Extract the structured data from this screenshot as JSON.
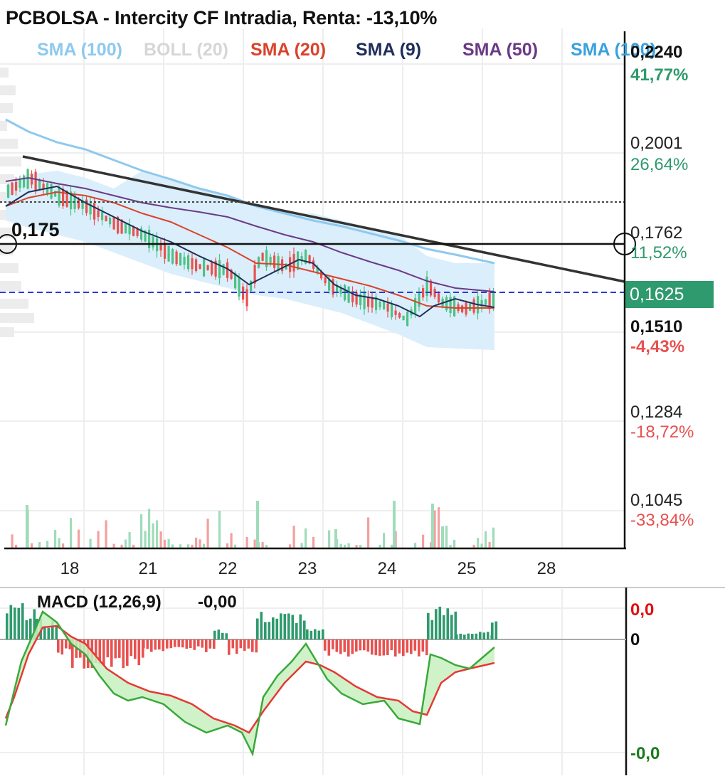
{
  "header": {
    "title": "PCBOLSA - Intercity CF Intradia, Renta: -13,10%"
  },
  "legend": [
    {
      "label": "SMA (100)",
      "color": "#8ec9ee"
    },
    {
      "label": "BOLL (20)",
      "color": "#d6d6d6"
    },
    {
      "label": "SMA (20)",
      "color": "#d9432b"
    },
    {
      "label": "SMA (9)",
      "color": "#1f2e5a"
    },
    {
      "label": "SMA (50)",
      "color": "#6a3a86"
    },
    {
      "label": "SMA (100)",
      "color": "#3aa2dc"
    }
  ],
  "price_axis": [
    {
      "price": "0,2240",
      "pct": "41,77%",
      "pct_color": "#2e9a6d",
      "bold": true
    },
    {
      "price": "0,2001",
      "pct": "26,64%",
      "pct_color": "#2e9a6d",
      "bold": false
    },
    {
      "price": "0,1762",
      "pct": "11,52%",
      "pct_color": "#2e9a6d",
      "bold": false
    },
    {
      "price": "0,1510",
      "pct": "-4,43%",
      "pct_color": "#e85050",
      "bold": true
    },
    {
      "price": "0,1284",
      "pct": "-18,72%",
      "pct_color": "#e85050",
      "bold": false
    },
    {
      "price": "0,1045",
      "pct": "-33,84%",
      "pct_color": "#e85050",
      "bold": false
    }
  ],
  "current_price": "0,1625",
  "horizontal_line_label": "0,175",
  "x_axis": [
    "18",
    "21",
    "22",
    "23",
    "24",
    "25",
    "28"
  ],
  "macd": {
    "label": "MACD (12,26,9)",
    "value": "-0,00",
    "axis_top": "0,0",
    "axis_mid": "0",
    "axis_bottom": "-0,0",
    "colors": {
      "top": "#e01010",
      "mid": "#111111",
      "bottom": "#1a7a1a"
    }
  },
  "chart_data": {
    "type": "candlestick",
    "x": [
      "18",
      "21",
      "22",
      "23",
      "24",
      "25"
    ],
    "close": [
      0.183,
      0.174,
      0.162,
      0.168,
      0.158,
      0.1625
    ],
    "ylim": [
      0.098,
      0.228
    ],
    "series": [
      {
        "name": "SMA (100)",
        "values": [
          0.208,
          0.195,
          0.184,
          0.178,
          0.173,
          0.167
        ]
      },
      {
        "name": "SMA (50)",
        "values": [
          0.187,
          0.181,
          0.174,
          0.17,
          0.166,
          0.163
        ]
      },
      {
        "name": "SMA (20)",
        "values": [
          0.182,
          0.175,
          0.168,
          0.165,
          0.16,
          0.159
        ]
      },
      {
        "name": "SMA (9)",
        "values": [
          0.18,
          0.172,
          0.165,
          0.167,
          0.158,
          0.16
        ]
      }
    ],
    "reference_lines": [
      {
        "label": "0,175",
        "value": 0.175
      },
      {
        "label": "0,1625",
        "value": 0.1625
      }
    ],
    "grid": true
  }
}
